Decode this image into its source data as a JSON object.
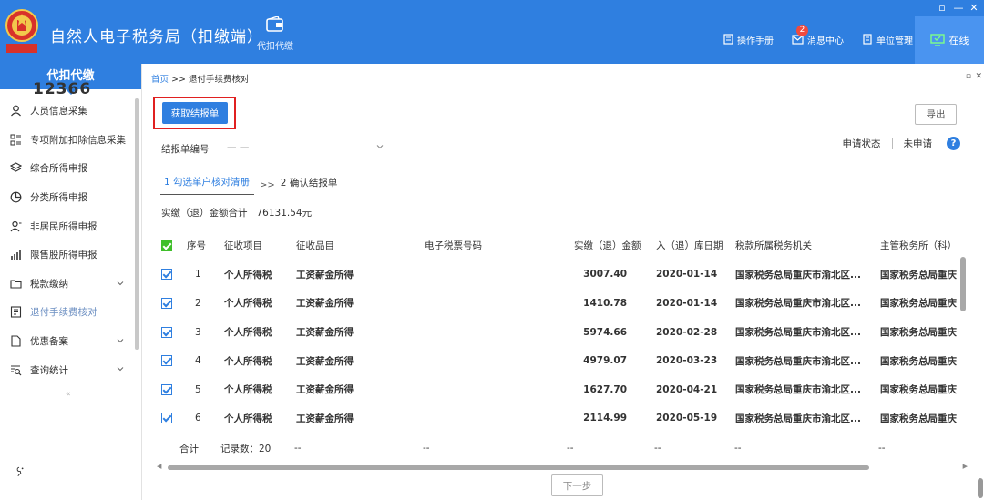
{
  "app": {
    "title": "自然人电子税务局（扣缴端）",
    "module_label": "代扣代缴",
    "actions": [
      {
        "label": "操作手册"
      },
      {
        "label": "消息中心",
        "badge": "2"
      },
      {
        "label": "单位管理"
      }
    ],
    "online_label": "在线",
    "window_controls": [
      "▫",
      "—",
      "✕"
    ]
  },
  "sidebar": {
    "header": "代扣代缴",
    "items": [
      {
        "label": "人员信息采集"
      },
      {
        "label": "专项附加扣除信息采集"
      },
      {
        "label": "综合所得申报"
      },
      {
        "label": "分类所得申报"
      },
      {
        "label": "非居民所得申报"
      },
      {
        "label": "限售股所得申报"
      },
      {
        "label": "税款缴纳"
      },
      {
        "label": "退付手续费核对"
      },
      {
        "label": "优惠备案"
      },
      {
        "label": "查询统计"
      }
    ],
    "collapse_glyph": "«",
    "hotline": {
      "number": "12366"
    }
  },
  "breadcrumb": {
    "home": "首页",
    "separator": ">>",
    "current": "退付手续费核对"
  },
  "panel_controls": [
    "▫",
    "✕"
  ],
  "toolbar": {
    "fetch_label": "获取结报单",
    "export_label": "导出"
  },
  "report": {
    "label": "结报单编号",
    "value": "— —"
  },
  "status": {
    "label": "申请状态",
    "value": "未申请",
    "help": "?"
  },
  "steps": {
    "step1": "1 勾选单户核对清册",
    "arrow": ">>",
    "step2": "2 确认结报单"
  },
  "total": {
    "label": "实缴（退）金额合计",
    "value": "76131.54元"
  },
  "table": {
    "headers": [
      "序号",
      "征收项目",
      "征收品目",
      "电子税票号码",
      "实缴（退）金额",
      "入（退）库日期",
      "税款所属税务机关",
      "主管税务所（科）"
    ],
    "rows": [
      {
        "no": "1",
        "item": "个人所得税",
        "subitem": "工资薪金所得",
        "ticket": "",
        "amount": "3007.40",
        "date": "2020-01-14",
        "office": "国家税务总局重庆市渝北区...",
        "branch": "国家税务总局重庆"
      },
      {
        "no": "2",
        "item": "个人所得税",
        "subitem": "工资薪金所得",
        "ticket": "",
        "amount": "1410.78",
        "date": "2020-01-14",
        "office": "国家税务总局重庆市渝北区...",
        "branch": "国家税务总局重庆"
      },
      {
        "no": "3",
        "item": "个人所得税",
        "subitem": "工资薪金所得",
        "ticket": "",
        "amount": "5974.66",
        "date": "2020-02-28",
        "office": "国家税务总局重庆市渝北区...",
        "branch": "国家税务总局重庆"
      },
      {
        "no": "4",
        "item": "个人所得税",
        "subitem": "工资薪金所得",
        "ticket": "",
        "amount": "4979.07",
        "date": "2020-03-23",
        "office": "国家税务总局重庆市渝北区...",
        "branch": "国家税务总局重庆"
      },
      {
        "no": "5",
        "item": "个人所得税",
        "subitem": "工资薪金所得",
        "ticket": "",
        "amount": "1627.70",
        "date": "2020-04-21",
        "office": "国家税务总局重庆市渝北区...",
        "branch": "国家税务总局重庆"
      },
      {
        "no": "6",
        "item": "个人所得税",
        "subitem": "工资薪金所得",
        "ticket": "",
        "amount": "2114.99",
        "date": "2020-05-19",
        "office": "国家税务总局重庆市渝北区...",
        "branch": "国家税务总局重庆"
      }
    ],
    "footer": {
      "label": "合计",
      "count": "记录数：20",
      "placeholders": [
        "--",
        "--",
        "--",
        "--",
        "--",
        "--"
      ]
    }
  },
  "next_label": "下一步",
  "colors": {
    "brand_blue": "#2f7fe0",
    "highlight_red": "#e02020",
    "check_green": "#3fbf2a",
    "badge_red": "#f04a3e"
  }
}
